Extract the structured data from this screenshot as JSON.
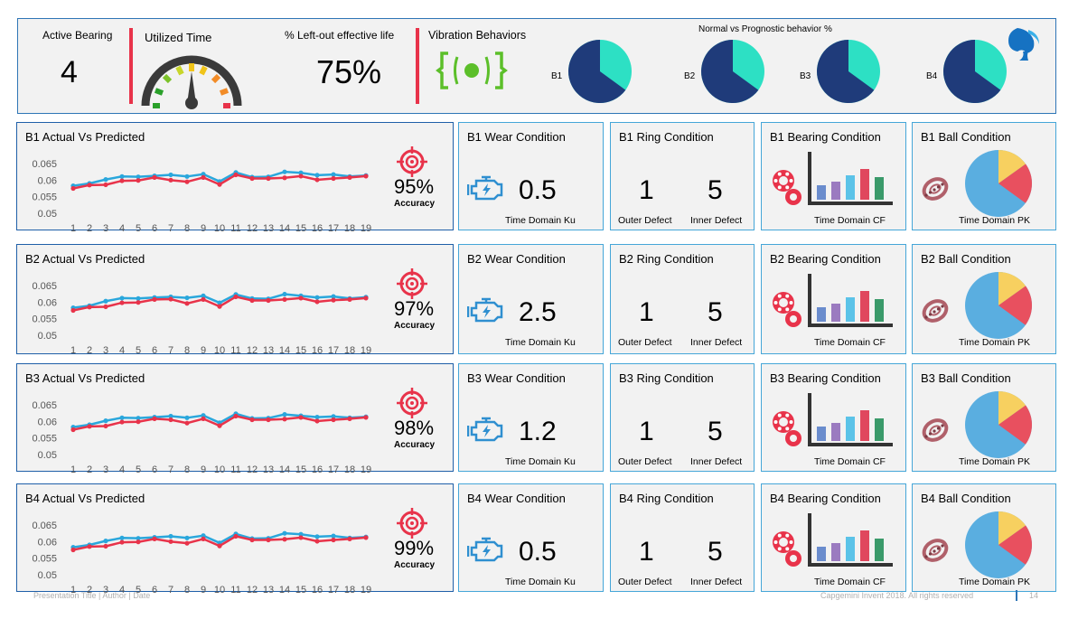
{
  "header": {
    "active_bearing_label": "Active Bearing",
    "active_bearing_value": "4",
    "utilized_time_label": "Utilized Time",
    "left_out_label": "% Left-out effective life",
    "left_out_value": "75%",
    "vibration_label": "Vibration Behaviors",
    "normal_vs_prognostic_title": "Normal vs Prognostic behavior %",
    "pies": [
      {
        "label": "B1",
        "normal_fraction": 0.65
      },
      {
        "label": "B2",
        "normal_fraction": 0.65
      },
      {
        "label": "B3",
        "normal_fraction": 0.65
      },
      {
        "label": "B4",
        "normal_fraction": 0.65
      }
    ]
  },
  "colors": {
    "navy": "#1f3b7a",
    "teal": "#2de0c4",
    "actual_line": "#2aa7dc",
    "predicted_line": "#e8334a",
    "panel_bg": "#f2f2f2",
    "chart_border": "#1f5fa8",
    "card_border": "#45a6d8",
    "accent_red": "#e8334a",
    "vibration_green": "#5cbf2a"
  },
  "rows": [
    {
      "chart_title": "B1 Actual Vs Predicted",
      "accuracy_value": "95%",
      "accuracy_label": "Accuracy",
      "wear_title": "B1  Wear Condition",
      "wear_value": "0.5",
      "wear_caption": "Time Domain Ku",
      "ring_title": "B1  Ring Condition",
      "ring_outer_value": "1",
      "ring_inner_value": "5",
      "ring_outer_label": "Outer  Defect",
      "ring_inner_label": "Inner Defect",
      "bearing_title": "B1  Bearing Condition",
      "bearing_caption": "Time Domain CF",
      "ball_title": "B1  Ball Condition",
      "ball_caption": "Time Domain PK"
    },
    {
      "chart_title": "B2 Actual Vs Predicted",
      "accuracy_value": "97%",
      "accuracy_label": "Accuracy",
      "wear_title": "B2 Wear Condition",
      "wear_value": "2.5",
      "wear_caption": "Time Domain Ku",
      "ring_title": "B2  Ring Condition",
      "ring_outer_value": "1",
      "ring_inner_value": "5",
      "ring_outer_label": "Outer  Defect",
      "ring_inner_label": "Inner Defect",
      "bearing_title": "B2  Bearing Condition",
      "bearing_caption": "Time Domain CF",
      "ball_title": "B2  Ball Condition",
      "ball_caption": "Time Domain PK"
    },
    {
      "chart_title": "B3 Actual Vs Predicted",
      "accuracy_value": "98%",
      "accuracy_label": "Accuracy",
      "wear_title": "B3 Wear Condition",
      "wear_value": "1.2",
      "wear_caption": "Time Domain Ku",
      "ring_title": "B3  Ring Condition",
      "ring_outer_value": "1",
      "ring_inner_value": "5",
      "ring_outer_label": "Outer  Defect",
      "ring_inner_label": "Inner Defect",
      "bearing_title": "B3  Bearing Condition",
      "bearing_caption": "Time Domain CF",
      "ball_title": "B3  Ball Condition",
      "ball_caption": "Time Domain PK"
    },
    {
      "chart_title": "B4 Actual Vs Predicted",
      "accuracy_value": "99%",
      "accuracy_label": "Accuracy",
      "wear_title": "B4 Wear Condition",
      "wear_value": "0.5",
      "wear_caption": "Time Domain Ku",
      "ring_title": "B4  Ring Condition",
      "ring_outer_value": "1",
      "ring_inner_value": "5",
      "ring_outer_label": "Outer  Defect",
      "ring_inner_label": "Inner Defect",
      "bearing_title": "B4  Bearing Condition",
      "bearing_caption": "Time Domain CF",
      "ball_title": "B4  Ball Condition",
      "ball_caption": "Time Domain PK"
    }
  ],
  "chart_data": [
    {
      "type": "line",
      "x": [
        1,
        2,
        3,
        4,
        5,
        6,
        7,
        8,
        9,
        10,
        11,
        12,
        13,
        14,
        15,
        16,
        17,
        18,
        19
      ],
      "ylim": [
        0.05,
        0.065
      ],
      "yticks": [
        "0.065",
        "0.06",
        "0.055",
        "0.05"
      ],
      "series": [
        {
          "values": [
            0.0583,
            0.059,
            0.0602,
            0.0611,
            0.061,
            0.0613,
            0.0616,
            0.0611,
            0.0618,
            0.0596,
            0.0623,
            0.0609,
            0.061,
            0.0625,
            0.0622,
            0.0615,
            0.0617,
            0.0611,
            0.0614
          ]
        },
        {
          "values": [
            0.0575,
            0.0585,
            0.0586,
            0.0598,
            0.0599,
            0.0608,
            0.06,
            0.0595,
            0.0608,
            0.0587,
            0.0616,
            0.0605,
            0.0605,
            0.0607,
            0.0612,
            0.0601,
            0.0605,
            0.0608,
            0.0612
          ]
        }
      ]
    },
    {
      "type": "line",
      "x": [
        1,
        2,
        3,
        4,
        5,
        6,
        7,
        8,
        9,
        10,
        11,
        12,
        13,
        14,
        15,
        16,
        17,
        18,
        19
      ],
      "ylim": [
        0.05,
        0.065
      ],
      "yticks": [
        "0.065",
        "0.06",
        "0.055",
        "0.05"
      ],
      "series": [
        {
          "values": [
            0.0583,
            0.0589,
            0.0603,
            0.0612,
            0.0611,
            0.0614,
            0.0616,
            0.0613,
            0.0619,
            0.0598,
            0.0623,
            0.0611,
            0.061,
            0.0624,
            0.0619,
            0.0614,
            0.0617,
            0.0611,
            0.0615
          ]
        },
        {
          "values": [
            0.0575,
            0.0585,
            0.0586,
            0.0598,
            0.0599,
            0.0608,
            0.0609,
            0.0596,
            0.0608,
            0.0587,
            0.0616,
            0.0605,
            0.0605,
            0.0608,
            0.0612,
            0.0601,
            0.0606,
            0.0608,
            0.0612
          ]
        }
      ]
    },
    {
      "type": "line",
      "x": [
        1,
        2,
        3,
        4,
        5,
        6,
        7,
        8,
        9,
        10,
        11,
        12,
        13,
        14,
        15,
        16,
        17,
        18,
        19
      ],
      "ylim": [
        0.05,
        0.065
      ],
      "yticks": [
        "0.065",
        "0.06",
        "0.055",
        "0.05"
      ],
      "series": [
        {
          "values": [
            0.0583,
            0.059,
            0.0602,
            0.0611,
            0.061,
            0.0613,
            0.0616,
            0.0611,
            0.0618,
            0.0596,
            0.0623,
            0.0609,
            0.061,
            0.0621,
            0.0617,
            0.0613,
            0.0615,
            0.0611,
            0.0614
          ]
        },
        {
          "values": [
            0.0575,
            0.0585,
            0.0586,
            0.0598,
            0.0599,
            0.0608,
            0.0605,
            0.0595,
            0.0608,
            0.0587,
            0.0616,
            0.0605,
            0.0605,
            0.0607,
            0.0612,
            0.0601,
            0.0605,
            0.0608,
            0.0612
          ]
        }
      ]
    },
    {
      "type": "line",
      "x": [
        1,
        2,
        3,
        4,
        5,
        6,
        7,
        8,
        9,
        10,
        11,
        12,
        13,
        14,
        15,
        16,
        17,
        18,
        19
      ],
      "ylim": [
        0.05,
        0.065
      ],
      "yticks": [
        "0.065",
        "0.06",
        "0.055",
        "0.05"
      ],
      "series": [
        {
          "values": [
            0.0583,
            0.059,
            0.0602,
            0.0611,
            0.061,
            0.0613,
            0.0616,
            0.0611,
            0.0618,
            0.0596,
            0.0623,
            0.0609,
            0.061,
            0.0625,
            0.0622,
            0.0615,
            0.0617,
            0.0611,
            0.0614
          ]
        },
        {
          "values": [
            0.0575,
            0.0585,
            0.0586,
            0.0598,
            0.0599,
            0.0608,
            0.06,
            0.0595,
            0.0608,
            0.0587,
            0.0616,
            0.0605,
            0.0605,
            0.0607,
            0.0612,
            0.0601,
            0.0605,
            0.0608,
            0.0612
          ]
        }
      ]
    }
  ],
  "footer": {
    "left": "Presentation Title | Author | Date",
    "right": "Capgemini Invent 2018. All rights reserved",
    "page_number": "14"
  }
}
